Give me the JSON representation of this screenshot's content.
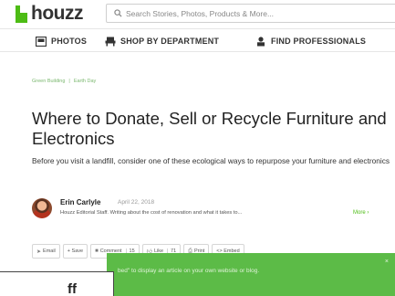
{
  "header": {
    "logo": "houzz",
    "search_placeholder": "Search Stories, Photos, Products & More..."
  },
  "nav": {
    "photos": "PHOTOS",
    "shop": "SHOP BY DEPARTMENT",
    "pros": "FIND PROFESSIONALS"
  },
  "article": {
    "breadcrumbs": [
      "Green Building",
      "|",
      "Earth Day"
    ],
    "title": "Where to Donate, Sell or Recycle Furniture and Electronics",
    "subtitle": "Before you visit a landfill, consider one of these ecological ways to repurpose your furniture and electronics",
    "author": {
      "name": "Erin Carlyle",
      "date": "April 22, 2018",
      "bio": "Houzz Editorial Staff. Writing about the cost of renovation and what it takes to...",
      "more": "More ›"
    },
    "actions": {
      "email": "Email",
      "save": "+ Save",
      "comment": "Comment",
      "comment_count": "15",
      "like": "Like",
      "like_count": "71",
      "print": "Print",
      "embed": "<> Embed"
    }
  },
  "toast": {
    "text": "bed\" to display an article on your own website or blog.",
    "close": "×"
  },
  "overlay": {
    "text": "ff"
  },
  "colors": {
    "brand_green": "#4dbc15",
    "toast_green": "#5cbb47"
  }
}
